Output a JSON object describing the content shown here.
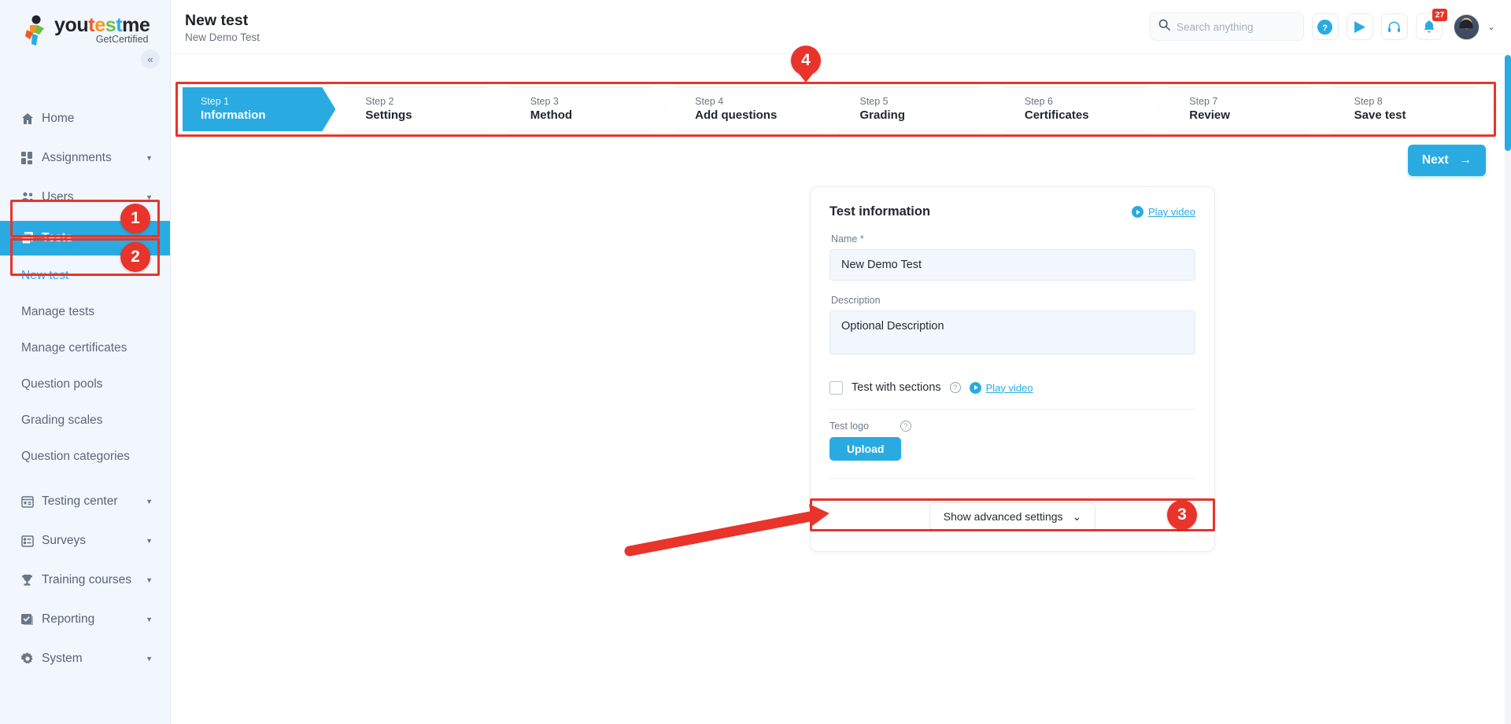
{
  "brand": {
    "name_parts": [
      "you",
      "t",
      "e",
      "s",
      "t",
      "me"
    ],
    "you": "you",
    "t1": "t",
    "e1": "e",
    "s1": "s",
    "t2": "t",
    "me": "me",
    "tagline": "GetCertified",
    "accent": "#29abe2",
    "annotation_color": "#e8342a"
  },
  "sidebar": {
    "collapse_icon": "«",
    "items": [
      {
        "label": "Home",
        "icon": "home-icon",
        "expandable": false
      },
      {
        "label": "Assignments",
        "icon": "assignments-icon",
        "expandable": true
      },
      {
        "label": "Users",
        "icon": "users-icon",
        "expandable": true
      },
      {
        "label": "Tests",
        "icon": "tests-icon",
        "expandable": true,
        "active": true
      }
    ],
    "sub_items": [
      {
        "label": "New test",
        "highlighted": true
      },
      {
        "label": "Manage tests"
      },
      {
        "label": "Manage certificates"
      },
      {
        "label": "Question pools"
      },
      {
        "label": "Grading scales"
      },
      {
        "label": "Question categories"
      }
    ],
    "items_bottom": [
      {
        "label": "Testing center",
        "icon": "testing-center-icon",
        "expandable": true
      },
      {
        "label": "Surveys",
        "icon": "surveys-icon",
        "expandable": true
      },
      {
        "label": "Training courses",
        "icon": "trophy-icon",
        "expandable": true
      },
      {
        "label": "Reporting",
        "icon": "reporting-icon",
        "expandable": true
      },
      {
        "label": "System",
        "icon": "gear-icon",
        "expandable": true
      }
    ]
  },
  "header": {
    "title": "New test",
    "subtitle": "New Demo Test",
    "search": {
      "placeholder": "Search anything",
      "value": ""
    },
    "icons": [
      {
        "name": "help-icon",
        "glyph": "?"
      },
      {
        "name": "play-icon",
        "glyph": "▶"
      },
      {
        "name": "headset-icon",
        "glyph": "headset"
      },
      {
        "name": "bell-icon",
        "glyph": "bell"
      }
    ],
    "notification_count": "27",
    "chevron": "⌄"
  },
  "stepper": {
    "steps": [
      {
        "num": "Step 1",
        "name": "Information",
        "active": true
      },
      {
        "num": "Step 2",
        "name": "Settings",
        "active": false
      },
      {
        "num": "Step 3",
        "name": "Method",
        "active": false
      },
      {
        "num": "Step 4",
        "name": "Add questions",
        "active": false
      },
      {
        "num": "Step 5",
        "name": "Grading",
        "active": false
      },
      {
        "num": "Step 6",
        "name": "Certificates",
        "active": false
      },
      {
        "num": "Step 7",
        "name": "Review",
        "active": false
      },
      {
        "num": "Step 8",
        "name": "Save test",
        "active": false
      }
    ]
  },
  "main": {
    "next_label": "Next",
    "next_arrow": "→",
    "card": {
      "title": "Test information",
      "play_video_label": "Play video",
      "name_label": "Name",
      "name_required": "*",
      "name_value": "New Demo Test",
      "description_label": "Description",
      "description_value": "Optional Description",
      "sections_label": "Test with sections",
      "sections_play_video": "Play video",
      "sections_checked": false,
      "logo_label": "Test logo",
      "upload_label": "Upload",
      "advanced_label": "Show advanced settings",
      "advanced_chevron": "⌄"
    }
  },
  "annotations": [
    {
      "number": "1",
      "target": "sidebar-item-tests"
    },
    {
      "number": "2",
      "target": "sidebar-subitem-new-test"
    },
    {
      "number": "3",
      "target": "test-with-sections-row"
    },
    {
      "number": "4",
      "target": "stepper"
    }
  ]
}
